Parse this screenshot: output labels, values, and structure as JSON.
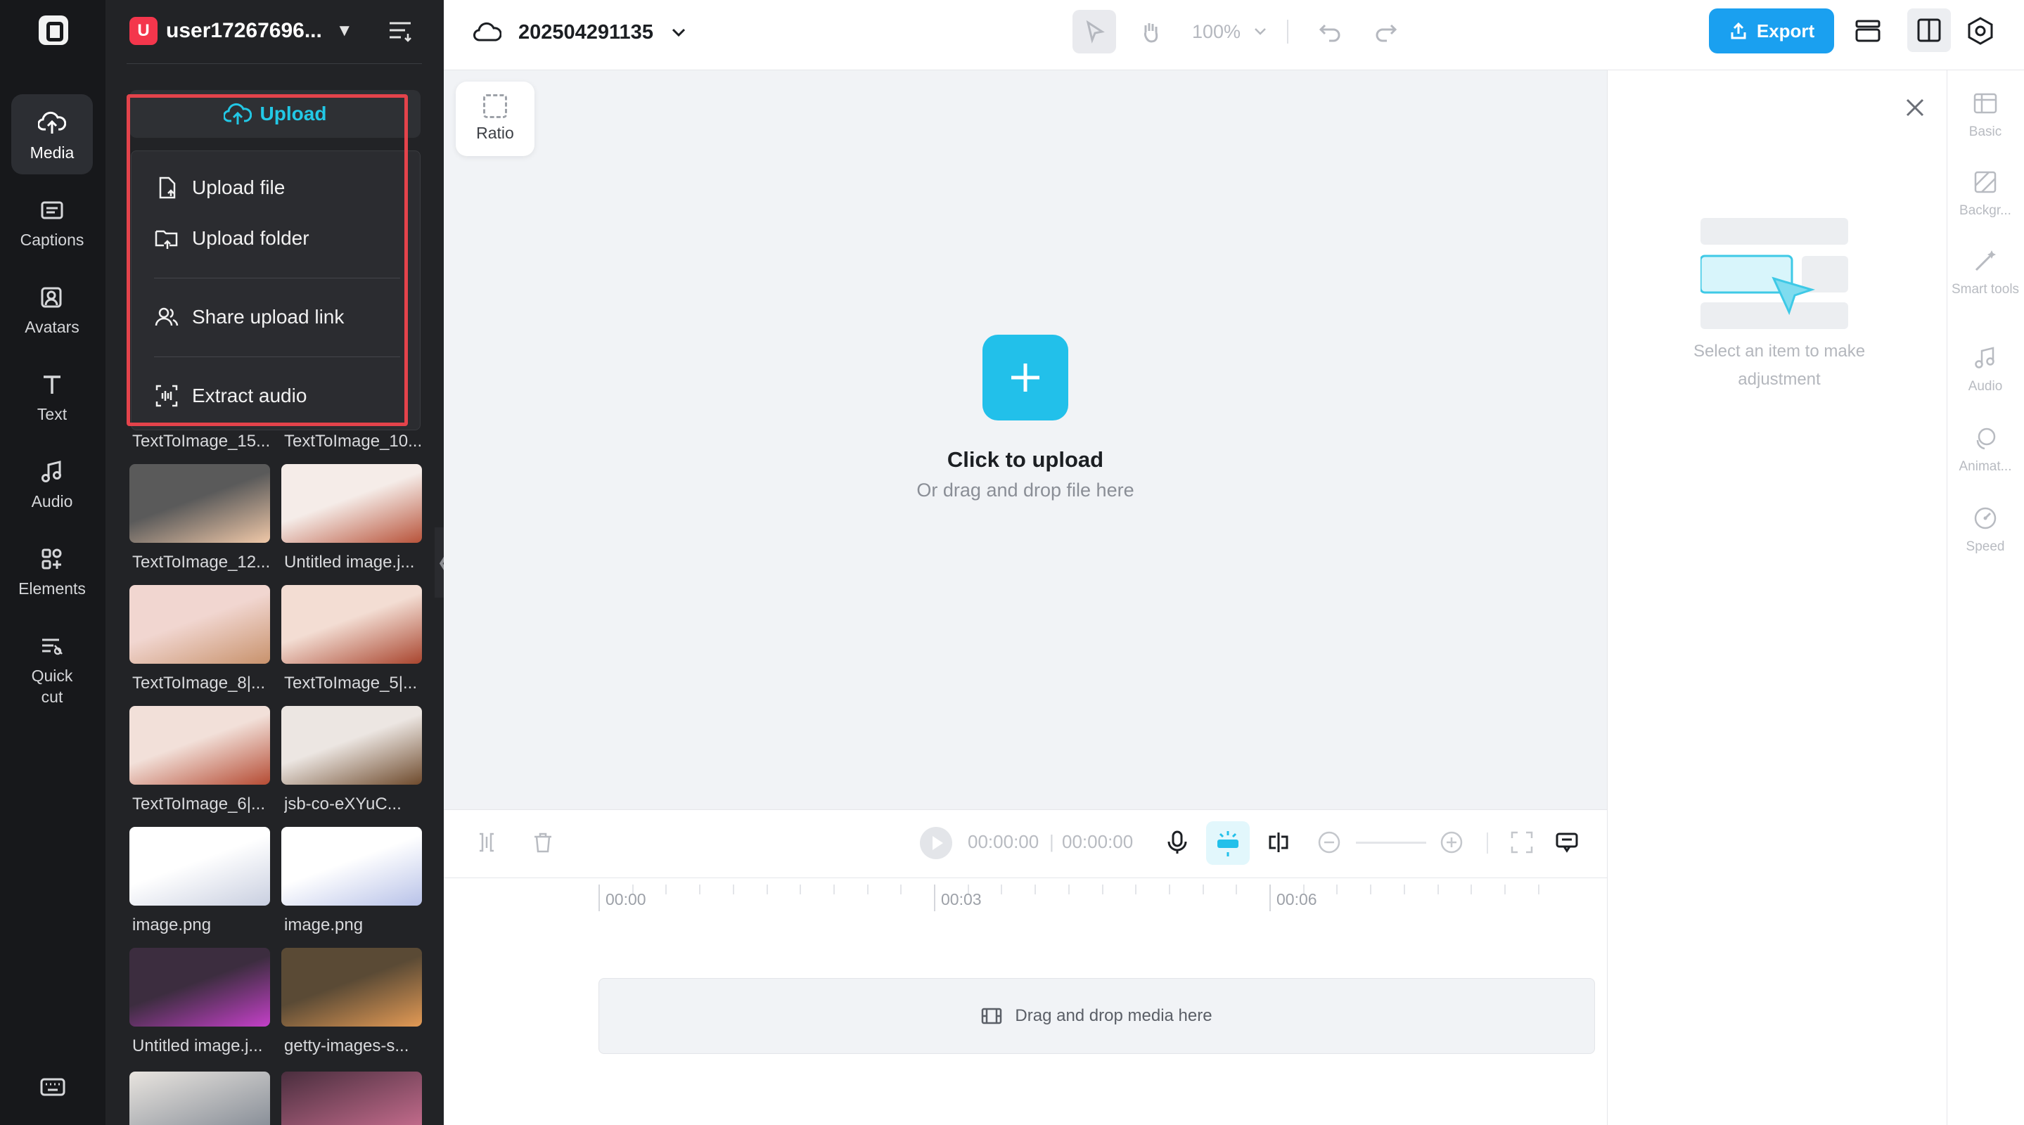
{
  "account": {
    "avatar_letter": "U",
    "name": "user17267696..."
  },
  "nav": [
    {
      "label": "Media",
      "icon": "cloud-upload-icon",
      "active": true
    },
    {
      "label": "Captions",
      "icon": "captions-icon"
    },
    {
      "label": "Avatars",
      "icon": "avatar-icon"
    },
    {
      "label": "Text",
      "icon": "text-icon"
    },
    {
      "label": "Audio",
      "icon": "music-note-icon"
    },
    {
      "label": "Elements",
      "icon": "elements-icon"
    },
    {
      "label": "Quick cut",
      "icon": "quick-cut-icon"
    }
  ],
  "upload": {
    "button_label": "Upload",
    "menu": [
      {
        "label": "Upload file",
        "icon": "file-upload-icon"
      },
      {
        "label": "Upload folder",
        "icon": "folder-upload-icon"
      },
      {
        "label": "Share upload link",
        "icon": "share-users-icon"
      },
      {
        "label": "Extract audio",
        "icon": "extract-audio-icon"
      }
    ]
  },
  "media_items": [
    {
      "label": "TextToImage_15..."
    },
    {
      "label": "TextToImage_10..."
    },
    {
      "label": "TextToImage_12..."
    },
    {
      "label": "Untitled image.j..."
    },
    {
      "label": "TextToImage_8|..."
    },
    {
      "label": "TextToImage_5|..."
    },
    {
      "label": "TextToImage_6|..."
    },
    {
      "label": "jsb-co-eXYuC..."
    },
    {
      "label": "image.png"
    },
    {
      "label": "image.png"
    },
    {
      "label": "Untitled image.j..."
    },
    {
      "label": "getty-images-s..."
    }
  ],
  "project": {
    "name": "202504291135"
  },
  "toolbar": {
    "zoom": "100%",
    "export_label": "Export"
  },
  "canvas": {
    "ratio_label": "Ratio",
    "cta": "Click to upload",
    "hint": "Or drag and drop file here"
  },
  "right_panel": {
    "hint_line1": "Select an item to make",
    "hint_line2": "adjustment"
  },
  "side_tabs": [
    {
      "label": "Basic",
      "icon": "basic-icon"
    },
    {
      "label": "Backgr...",
      "icon": "background-icon"
    },
    {
      "label": "Smart tools",
      "icon": "magic-wand-icon"
    },
    {
      "label": "Audio",
      "icon": "music-note-icon"
    },
    {
      "label": "Animat...",
      "icon": "animation-icon"
    },
    {
      "label": "Speed",
      "icon": "speed-icon"
    }
  ],
  "timeline": {
    "current_time": "00:00:00",
    "total_time": "00:00:00",
    "ruler": [
      "00:00",
      "00:03",
      "00:06"
    ],
    "drop_hint": "Drag and drop media here"
  },
  "colors": {
    "accent": "#22c0ea",
    "export": "#1aa0f0",
    "highlight": "#e4434b"
  }
}
